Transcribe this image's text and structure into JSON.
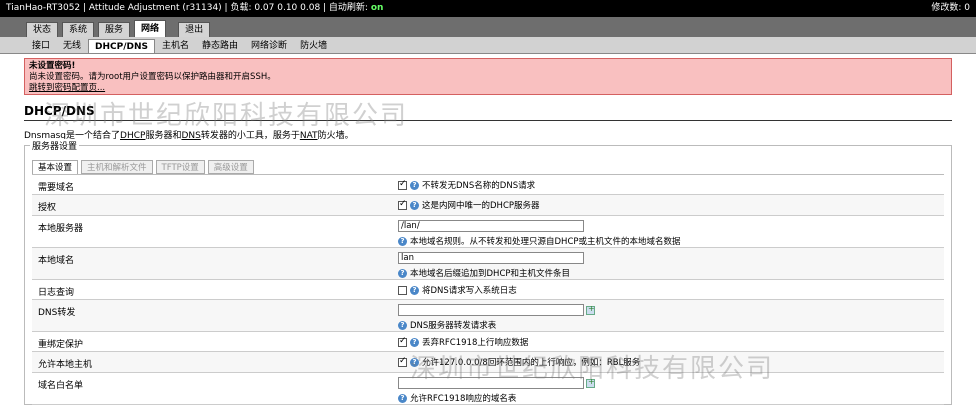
{
  "topbar": {
    "left": "TianHao-RT3052 | Attitude Adjustment (r31134) | 负载: 0.07 0.10 0.08 | 自动刷新: ",
    "refresh_state": "on",
    "right": "修改数: 0"
  },
  "mainnav": {
    "tabs": [
      {
        "label": "状态"
      },
      {
        "label": "系统"
      },
      {
        "label": "服务"
      },
      {
        "label": "网络",
        "active": true
      },
      {
        "label": "退出"
      }
    ]
  },
  "subnav": {
    "tabs": [
      {
        "label": "接口"
      },
      {
        "label": "无线"
      },
      {
        "label": "DHCP/DNS",
        "active": true
      },
      {
        "label": "主机名"
      },
      {
        "label": "静态路由"
      },
      {
        "label": "网络诊断"
      },
      {
        "label": "防火墙"
      }
    ]
  },
  "alert": {
    "title": "未设置密码!",
    "message": "尚未设置密码。请为root用户设置密码以保护路由器和开启SSH。",
    "link": "跳转到密码配置页..."
  },
  "page": {
    "title": "DHCP/DNS",
    "desc_1": "Dnsmasq是一个结合了",
    "desc_dhcp": "DHCP",
    "desc_2": "服务器和",
    "desc_dns": "DNS",
    "desc_3": "转发器的小工具，服务于",
    "desc_nat": "NAT",
    "desc_4": "防火墙。",
    "section": "服务器设置"
  },
  "innertabs": [
    {
      "label": "基本设置",
      "active": true
    },
    {
      "label": "主机和解析文件"
    },
    {
      "label": "TFTP设置"
    },
    {
      "label": "高级设置"
    }
  ],
  "rows": {
    "domainneeded": {
      "label": "需要域名",
      "text": "不转发无DNS名称的DNS请求"
    },
    "authoritative": {
      "label": "授权",
      "text": "这是内网中唯一的DHCP服务器"
    },
    "local": {
      "label": "本地服务器",
      "value": "/lan/",
      "hint": "本地域名规则。从不转发和处理只源自DHCP或主机文件的本地域名数据"
    },
    "domain": {
      "label": "本地域名",
      "value": "lan",
      "hint": "本地域名后缀追加到DHCP和主机文件条目"
    },
    "logqueries": {
      "label": "日志查询",
      "text": "将DNS请求写入系统日志"
    },
    "dnsforward": {
      "label": "DNS转发",
      "value": "",
      "hint": "DNS服务器转发请求表"
    },
    "rebind": {
      "label": "重绑定保护",
      "text": "丢弃RFC1918上行响应数据"
    },
    "localhost": {
      "label": "允许本地主机",
      "text": "允许127.0.0.0/8回环范围内的上行响应，例如：RBL服务"
    },
    "whitelist": {
      "label": "域名白名单",
      "value": "",
      "hint": "允许RFC1918响应的域名表"
    }
  },
  "watermark": "深圳市世纪欣阳科技有限公司"
}
